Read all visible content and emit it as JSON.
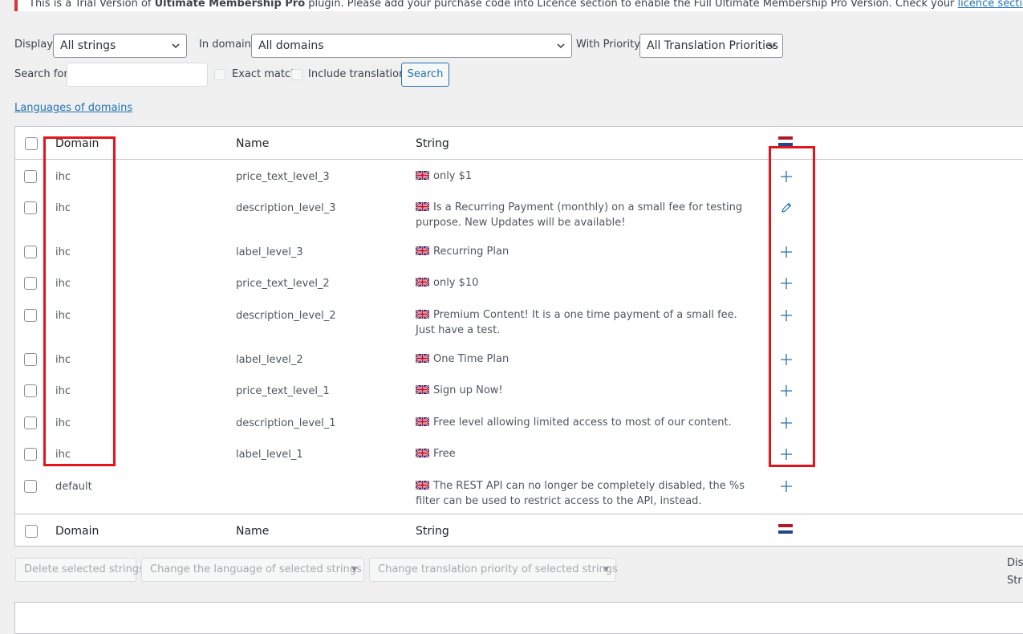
{
  "notice": {
    "prefix": "This is a Trial Version of ",
    "plugin_name": "Ultimate Membership Pro",
    "middle": " plugin. Please add your purchase code into Licence section to enable the Full Ultimate Membership Pro Version. Check your ",
    "link": "licence section",
    "suffix": "."
  },
  "filters": {
    "display_label": "Display:",
    "display_value": "All strings",
    "domain_label": "In domain:",
    "domain_value": "All domains",
    "priority_label": "With Priority:",
    "priority_value": "All Translation Priorities"
  },
  "search": {
    "label": "Search for:",
    "value": "",
    "exact_match": "Exact match",
    "include_translations": "Include translations",
    "button": "Search"
  },
  "languages_link": "Languages of domains",
  "table": {
    "headers": {
      "domain": "Domain",
      "name": "Name",
      "string": "String"
    },
    "rows": [
      {
        "domain": "ihc",
        "name": "price_text_level_3",
        "string": "only $1",
        "action": "plus-icon"
      },
      {
        "domain": "ihc",
        "name": "description_level_3",
        "string": "Is a Recurring Payment (monthly) on a small fee for testing purpose. New Updates will be available!",
        "action": "pencil-icon"
      },
      {
        "domain": "ihc",
        "name": "label_level_3",
        "string": "Recurring Plan",
        "action": "plus-icon"
      },
      {
        "domain": "ihc",
        "name": "price_text_level_2",
        "string": "only $10",
        "action": "plus-icon"
      },
      {
        "domain": "ihc",
        "name": "description_level_2",
        "string": "Premium Content! It is a one time payment of a small fee. Just have a test.",
        "action": "plus-icon"
      },
      {
        "domain": "ihc",
        "name": "label_level_2",
        "string": "One Time Plan",
        "action": "plus-icon"
      },
      {
        "domain": "ihc",
        "name": "price_text_level_1",
        "string": "Sign up Now!",
        "action": "plus-icon"
      },
      {
        "domain": "ihc",
        "name": "description_level_1",
        "string": "Free level allowing limited access to most of our content.",
        "action": "plus-icon"
      },
      {
        "domain": "ihc",
        "name": "label_level_1",
        "string": "Free",
        "action": "plus-icon"
      },
      {
        "domain": "default",
        "name": "",
        "string": "The REST API can no longer be completely disabled, the %s filter can be used to restrict access to the API, instead.",
        "action": "plus-icon"
      }
    ]
  },
  "bulk": {
    "delete": "Delete selected strings",
    "change_language": "Change the language of selected strings",
    "change_priority": "Change translation priority of selected strings"
  },
  "side_text": {
    "line1": "Disp",
    "line2": "Stri"
  },
  "colors": {
    "link": "#2271b1",
    "highlight": "#e5141a",
    "notice_border": "#d63638",
    "action_icon": "#2271b1"
  }
}
